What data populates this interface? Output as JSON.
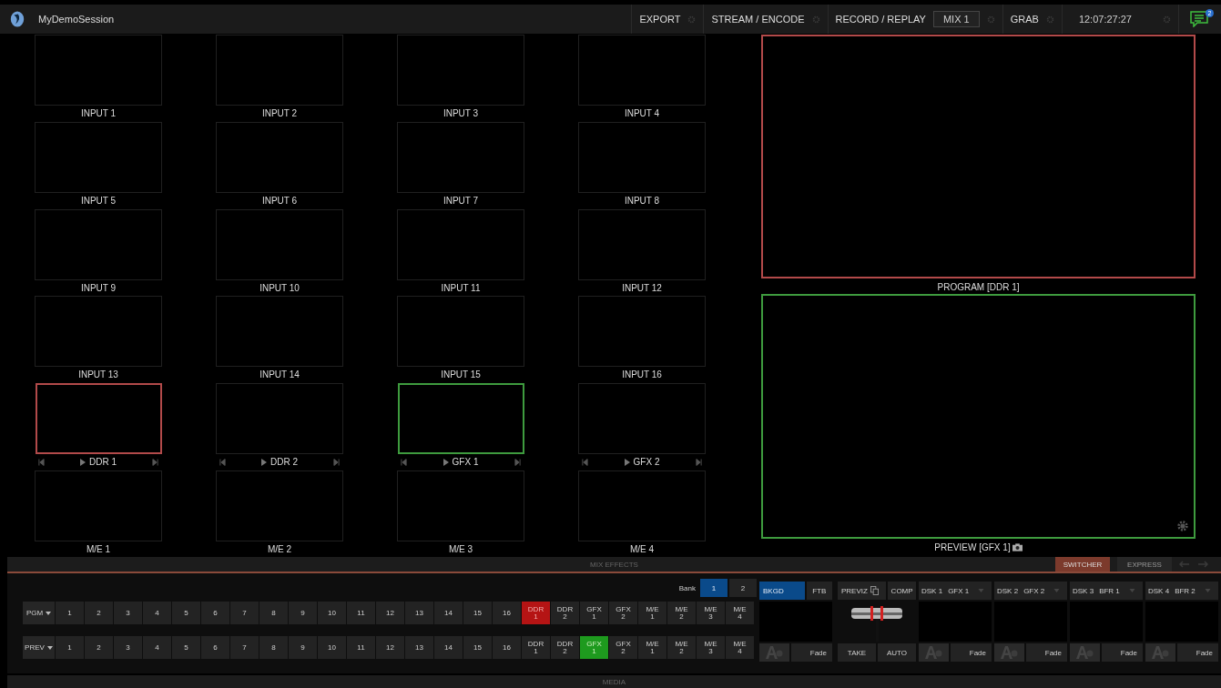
{
  "session": {
    "title": "MyDemoSession",
    "notification_count": "2"
  },
  "menus": [
    {
      "label": "EXPORT"
    },
    {
      "label": "STREAM / ENCODE"
    },
    {
      "label": "RECORD / REPLAY",
      "value": "MIX 1"
    },
    {
      "label": "GRAB"
    }
  ],
  "clock": "12:07:27:27",
  "monitors": [
    {
      "label": "INPUT 1",
      "kind": "input",
      "on_program": false,
      "on_preview": false
    },
    {
      "label": "INPUT 2",
      "kind": "input",
      "on_program": false,
      "on_preview": false
    },
    {
      "label": "INPUT 3",
      "kind": "input",
      "on_program": false,
      "on_preview": false
    },
    {
      "label": "INPUT 4",
      "kind": "input",
      "on_program": false,
      "on_preview": false
    },
    {
      "label": "INPUT 5",
      "kind": "input",
      "on_program": false,
      "on_preview": false
    },
    {
      "label": "INPUT 6",
      "kind": "input",
      "on_program": false,
      "on_preview": false
    },
    {
      "label": "INPUT 7",
      "kind": "input",
      "on_program": false,
      "on_preview": false
    },
    {
      "label": "INPUT 8",
      "kind": "input",
      "on_program": false,
      "on_preview": false
    },
    {
      "label": "INPUT 9",
      "kind": "input",
      "on_program": false,
      "on_preview": false
    },
    {
      "label": "INPUT 10",
      "kind": "input",
      "on_program": false,
      "on_preview": false
    },
    {
      "label": "INPUT 11",
      "kind": "input",
      "on_program": false,
      "on_preview": false
    },
    {
      "label": "INPUT 12",
      "kind": "input",
      "on_program": false,
      "on_preview": false
    },
    {
      "label": "INPUT 13",
      "kind": "input",
      "on_program": false,
      "on_preview": false
    },
    {
      "label": "INPUT 14",
      "kind": "input",
      "on_program": false,
      "on_preview": false
    },
    {
      "label": "INPUT 15",
      "kind": "input",
      "on_program": false,
      "on_preview": false
    },
    {
      "label": "INPUT 16",
      "kind": "input",
      "on_program": false,
      "on_preview": false
    },
    {
      "label": "DDR 1",
      "kind": "media",
      "on_program": true,
      "on_preview": false
    },
    {
      "label": "DDR 2",
      "kind": "media",
      "on_program": false,
      "on_preview": false
    },
    {
      "label": "GFX 1",
      "kind": "media",
      "on_program": false,
      "on_preview": true
    },
    {
      "label": "GFX 2",
      "kind": "media",
      "on_program": false,
      "on_preview": false
    },
    {
      "label": "M/E 1",
      "kind": "input",
      "on_program": false,
      "on_preview": false
    },
    {
      "label": "M/E 2",
      "kind": "input",
      "on_program": false,
      "on_preview": false
    },
    {
      "label": "M/E 3",
      "kind": "input",
      "on_program": false,
      "on_preview": false
    },
    {
      "label": "M/E 4",
      "kind": "input",
      "on_program": false,
      "on_preview": false
    }
  ],
  "program": {
    "label": "PROGRAM [DDR 1]"
  },
  "preview": {
    "label": "PREVIEW [GFX 1]"
  },
  "mix_effects": {
    "title": "MIX EFFECTS",
    "tabs": [
      {
        "label": "SWITCHER",
        "selected": true
      },
      {
        "label": "EXPRESS",
        "selected": false
      }
    ]
  },
  "switcher": {
    "bank_label": "Bank",
    "banks": [
      {
        "label": "1",
        "selected": true
      },
      {
        "label": "2",
        "selected": false
      }
    ],
    "rows": [
      {
        "label": "PGM",
        "kind": "program",
        "buttons": [
          {
            "label": "1",
            "selected": false
          },
          {
            "label": "2",
            "selected": false
          },
          {
            "label": "3",
            "selected": false
          },
          {
            "label": "4",
            "selected": false
          },
          {
            "label": "5",
            "selected": false
          },
          {
            "label": "6",
            "selected": false
          },
          {
            "label": "7",
            "selected": false
          },
          {
            "label": "8",
            "selected": false
          },
          {
            "label": "9",
            "selected": false
          },
          {
            "label": "10",
            "selected": false
          },
          {
            "label": "11",
            "selected": false
          },
          {
            "label": "12",
            "selected": false
          },
          {
            "label": "13",
            "selected": false
          },
          {
            "label": "14",
            "selected": false
          },
          {
            "label": "15",
            "selected": false
          },
          {
            "label": "16",
            "selected": false
          },
          {
            "label": "DDR 1",
            "selected": true
          },
          {
            "label": "DDR 2",
            "selected": false
          },
          {
            "label": "GFX 1",
            "selected": false
          },
          {
            "label": "GFX 2",
            "selected": false
          },
          {
            "label": "M/E 1",
            "selected": false
          },
          {
            "label": "M/E 2",
            "selected": false
          },
          {
            "label": "M/E 3",
            "selected": false
          },
          {
            "label": "M/E 4",
            "selected": false
          }
        ]
      },
      {
        "label": "PREV",
        "kind": "preview",
        "buttons": [
          {
            "label": "1",
            "selected": false
          },
          {
            "label": "2",
            "selected": false
          },
          {
            "label": "3",
            "selected": false
          },
          {
            "label": "4",
            "selected": false
          },
          {
            "label": "5",
            "selected": false
          },
          {
            "label": "6",
            "selected": false
          },
          {
            "label": "7",
            "selected": false
          },
          {
            "label": "8",
            "selected": false
          },
          {
            "label": "9",
            "selected": false
          },
          {
            "label": "10",
            "selected": false
          },
          {
            "label": "11",
            "selected": false
          },
          {
            "label": "12",
            "selected": false
          },
          {
            "label": "13",
            "selected": false
          },
          {
            "label": "14",
            "selected": false
          },
          {
            "label": "15",
            "selected": false
          },
          {
            "label": "16",
            "selected": false
          },
          {
            "label": "DDR 1",
            "selected": false
          },
          {
            "label": "DDR 2",
            "selected": false
          },
          {
            "label": "GFX 1",
            "selected": true
          },
          {
            "label": "GFX 2",
            "selected": false
          },
          {
            "label": "M/E 1",
            "selected": false
          },
          {
            "label": "M/E 2",
            "selected": false
          },
          {
            "label": "M/E 3",
            "selected": false
          },
          {
            "label": "M/E 4",
            "selected": false
          }
        ]
      }
    ]
  },
  "transition": {
    "buttons": [
      {
        "label": "BKGD",
        "selected": true
      },
      {
        "label": "FTB",
        "selected": false
      }
    ],
    "effect": "Fade"
  },
  "take_controls": {
    "previz": "PREVIZ",
    "comp": "COMP",
    "take": "TAKE",
    "auto": "AUTO"
  },
  "dsks": [
    {
      "label": "DSK 1",
      "source": "GFX 1",
      "effect": "Fade"
    },
    {
      "label": "DSK 2",
      "source": "GFX 2",
      "effect": "Fade"
    },
    {
      "label": "DSK 3",
      "source": "BFR 1",
      "effect": "Fade"
    },
    {
      "label": "DSK 4",
      "source": "BFR 2",
      "effect": "Fade"
    }
  ],
  "media_bar": {
    "title": "MEDIA"
  }
}
